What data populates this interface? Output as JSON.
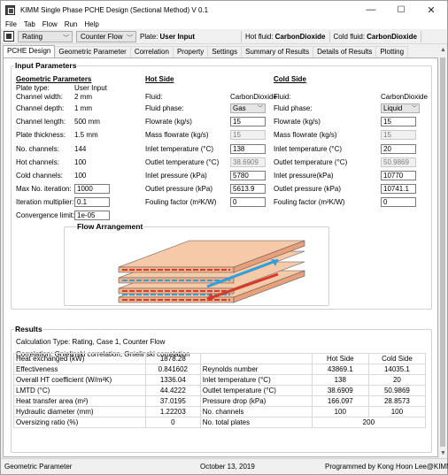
{
  "window": {
    "title": "KIMM Single Phase PCHE Design (Sectional Method) V 0.1",
    "min": "—",
    "max": "☐",
    "close": "✕"
  },
  "menu": [
    "File",
    "Tab",
    "Flow",
    "Run",
    "Help"
  ],
  "toolbar": {
    "mode": "Rating",
    "flow": "Counter Flow",
    "plate_label": "Plate:",
    "plate_value": "User Input",
    "hot_label": "Hot fluid:",
    "hot_value": "CarbonDioxide",
    "cold_label": "Cold fluid:",
    "cold_value": "CarbonDioxide"
  },
  "tabs": [
    "PCHE Design",
    "Geometric Parameter",
    "Correlation",
    "Property",
    "Settings",
    "Summary of Results",
    "Details of Results",
    "Plotting"
  ],
  "input": {
    "title": "Input Parameters",
    "geo_title": "Geometric Parameters",
    "geo": [
      {
        "label": "Plate type:",
        "value": "User Input"
      },
      {
        "label": "Channel width:",
        "value": "2 mm"
      },
      {
        "label": "Channel depth:",
        "value": "1 mm"
      },
      {
        "label": "Channel length:",
        "value": "500 mm"
      },
      {
        "label": "Plate thickness:",
        "value": "1.5 mm"
      },
      {
        "label": "No. channels:",
        "value": "144"
      },
      {
        "label": "Hot channels:",
        "value": "100"
      },
      {
        "label": "Cold channels:",
        "value": "100"
      }
    ],
    "max_iter_label": "Max No. iteration:",
    "max_iter": "1000",
    "iter_mult_label": "Iteration multiplier:",
    "iter_mult": "0.1",
    "conv_label": "Convergence limit:",
    "conv": "1e-05",
    "hot_title": "Hot Side",
    "cold_title": "Cold Side",
    "fluid_label": "Fluid:",
    "hot_fluid": "CarbonDioxide",
    "cold_fluid": "CarbonDioxide",
    "phase_label": "Fluid phase:",
    "hot_phase": "Gas",
    "cold_phase": "Liquid",
    "flowrate_label": "Flowrate (kg/s)",
    "hot_flowrate": "15",
    "cold_flowrate": "15",
    "mass_label": "Mass flowrate (kg/s)",
    "hot_mass": "15",
    "cold_mass": "15",
    "inlet_t_label": "Inlet temperature (°C)",
    "hot_inlet_t": "138",
    "cold_inlet_t": "20",
    "outlet_t_label": "Outlet temperature (°C)",
    "hot_outlet_t": "38.6909",
    "cold_outlet_t": "50.9869",
    "inlet_p_label_hot": "Inlet pressure (kPa)",
    "inlet_p_label_cold": "Inlet pressure(kPa)",
    "hot_inlet_p": "5780",
    "cold_inlet_p": "10770",
    "outlet_p_label": "Outlet pressure (kPa)",
    "hot_outlet_p": "5613.9",
    "cold_outlet_p": "10741.1",
    "fouling_label": "Fouling factor (m²K/W)",
    "hot_fouling": "0",
    "cold_fouling": "0"
  },
  "flow_arrangement": {
    "title": "Flow Arrangement",
    "colors": {
      "hot": "#d9382a",
      "cold": "#2f9fe0",
      "plate": "#f6c9a8"
    }
  },
  "results": {
    "title": "Results",
    "calc_type": "Calculation Type:   Rating, Case 1, Counter Flow",
    "correlation": "Correlation:   Gnielinski correlation, Gnielinski correlation",
    "header": {
      "hot": "Hot Side",
      "cold": "Cold Side"
    },
    "rows": [
      {
        "l": "Heat exchanged (kW)",
        "v": "1878.28",
        "p": "",
        "h": "Hot Side",
        "c": "Cold Side"
      },
      {
        "l": "Effectiveness",
        "v": "0.841602",
        "p": "Reynolds number",
        "h": "43869.1",
        "c": "14035.1"
      },
      {
        "l": "Overall HT coefficient (W/m²K)",
        "v": "1336.04",
        "p": "Inlet temperature (°C)",
        "h": "138",
        "c": "20"
      },
      {
        "l": "LMTD (°C)",
        "v": "44.4222",
        "p": "Outlet temperature (°C)",
        "h": "38.6909",
        "c": "50.9869"
      },
      {
        "l": "Heat transfer area (m²)",
        "v": "37.0195",
        "p": "Pressure drop (kPa)",
        "h": "166.097",
        "c": "28.8573"
      },
      {
        "l": "Hydraulic diameter (mm)",
        "v": "1.22203",
        "p": "No. channels",
        "h": "100",
        "c": "100"
      },
      {
        "l": "Oversizing ratio (%)",
        "v": "0",
        "p": "No. total plates",
        "h": "200",
        "c": ""
      }
    ]
  },
  "status": {
    "left": "Geometric Parameter",
    "center": "October 13, 2019",
    "right": "Programmed by Kong Hoon Lee@KIMM"
  }
}
